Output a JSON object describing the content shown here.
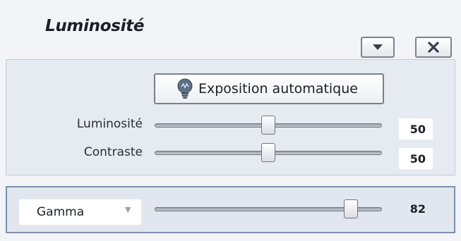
{
  "panel": {
    "title": "Luminosité",
    "dropdown_icon": "triangle-down-icon",
    "close_icon": "close-x-icon"
  },
  "auto_exposure": {
    "label": "Exposition automatique",
    "icon": "lightbulb-icon"
  },
  "sliders": [
    {
      "label": "Luminosité",
      "value": "50",
      "level": 0.5
    },
    {
      "label": "Contraste",
      "value": "50",
      "level": 0.5
    }
  ],
  "gamma": {
    "selected": "Gamma",
    "value": "82",
    "level": 0.865
  },
  "colors": {
    "panel_bg": "#e6eaf1",
    "gamma_border": "#7d90ad",
    "title_text": "#1b1f27"
  }
}
